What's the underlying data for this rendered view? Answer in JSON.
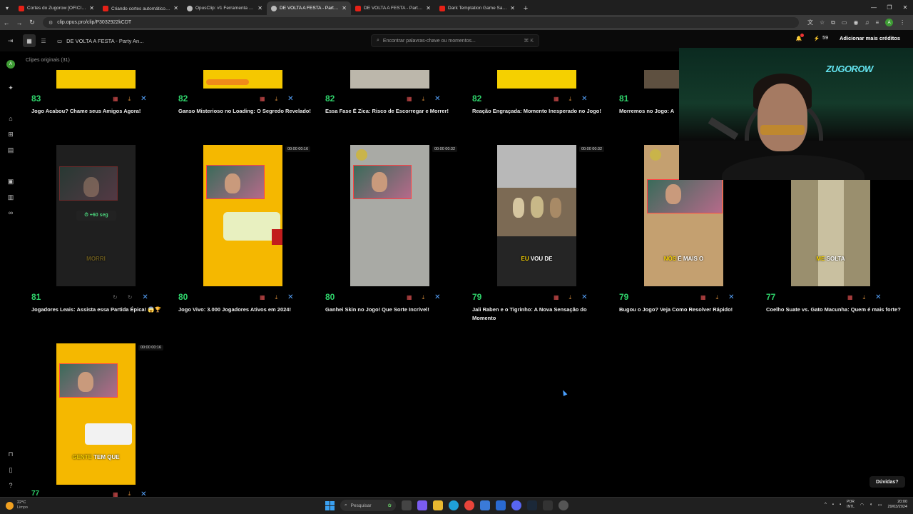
{
  "browser": {
    "tabs": [
      {
        "title": "Cortes do Zugorow [OFICIAL] -",
        "icon": "youtube",
        "active": false
      },
      {
        "title": "Criando cortes automáticos 👀",
        "icon": "youtube",
        "active": false
      },
      {
        "title": "OpusClip: #1 Ferramenta de re",
        "icon": "opus",
        "active": false
      },
      {
        "title": "DE VOLTA A FESTA - Party Anim",
        "icon": "opus",
        "active": true
      },
      {
        "title": "DE VOLTA A FESTA - Party Anim",
        "icon": "youtube",
        "active": false
      },
      {
        "title": "Dark Temptation Game Saga -",
        "icon": "youtube",
        "active": false
      }
    ],
    "url": "clip.opus.pro/clip/P3032922kCDT",
    "profile_initial": "A"
  },
  "header": {
    "project_title": "DE VOLTA A FESTA - Party An...",
    "search_placeholder": "Encontrar palavras-chave ou momentos...",
    "search_shortcut": "⌘ K",
    "credits": "59",
    "add_credits": "Adicionar mais créditos"
  },
  "sidebar": {
    "avatar_initial": "A"
  },
  "section_label": "Clipes originais  (31)",
  "clips_row1": [
    {
      "score": "83",
      "title": "Jogo Acabou? Chame seus Amigos Agora!"
    },
    {
      "score": "82",
      "title": "Ganso Misterioso no Loading: O Segredo Revelado!"
    },
    {
      "score": "82",
      "title": "Essa Fase É Zica: Risco de Escorregar e Morrer!"
    },
    {
      "score": "82",
      "title": "Reação Engraçada: Momento Inesperado no Jogo!"
    },
    {
      "score": "81",
      "title": "Morremos no Jogo: A"
    }
  ],
  "clips_row2": [
    {
      "score": "81",
      "title": "Jogadores Leais: Assista essa Partida Épica! 😱🏆",
      "time": "",
      "caption_pre": "",
      "caption_post": "",
      "overlay": "⏱ +60 seg",
      "overlay2": "MORRI"
    },
    {
      "score": "80",
      "title": "Jogo Vivo: 3.000 Jogadores Ativos em 2024!",
      "time": "00:00  00:16",
      "caption_pre": "",
      "caption_post": ""
    },
    {
      "score": "80",
      "title": "Ganhei Skin no Jogo! Que Sorte Incrível!",
      "time": "00:00  00:32",
      "caption_pre": "",
      "caption_post": ""
    },
    {
      "score": "79",
      "title": "Jali Raben e o Tigrinho: A Nova Sensação do Momento",
      "time": "00:00  00:32",
      "caption_pre": "EU",
      "caption_post": " VOU DE"
    },
    {
      "score": "79",
      "title": "Bugou o Jogo? Veja Como Resolver Rápido!",
      "time": "",
      "caption_pre": "NÓS",
      "caption_post": " É MAIS O"
    },
    {
      "score": "77",
      "title": "Coelho Suate vs. Gato Macunha: Quem é mais forte?",
      "time": "",
      "caption_pre": "ME",
      "caption_post": " SOLTA"
    }
  ],
  "clip_row3": {
    "time": "00:00  00:16",
    "caption_pre": "GENTE",
    "caption_post": " TEM QUE",
    "next_score": "77"
  },
  "help_button": "Dúvidas?",
  "taskbar": {
    "weather_temp": "22°C",
    "weather_desc": "Limpo",
    "search": "Pesquisar",
    "lang1": "POR",
    "lang2": "INTL",
    "time": "20:00",
    "date": "29/03/2024"
  }
}
